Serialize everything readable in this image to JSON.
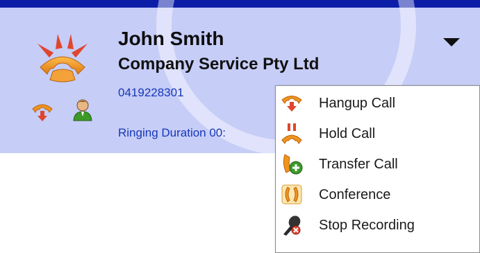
{
  "caller": {
    "name": "John Smith",
    "company": "Company Service Pty Ltd",
    "phone": "0419228301",
    "ringing_duration": "Ringing Duration  00:"
  },
  "icons": {
    "ringing": "ringing-phone-icon",
    "hangup_small": "hangup-phone-icon",
    "contact_small": "contact-person-icon",
    "menu_toggle": "dropdown-arrow-icon"
  },
  "menu": {
    "items": [
      {
        "label": "Hangup Call",
        "icon": "hangup-phone-icon"
      },
      {
        "label": "Hold Call",
        "icon": "hold-phone-icon"
      },
      {
        "label": "Transfer Call",
        "icon": "transfer-call-icon"
      },
      {
        "label": "Conference",
        "icon": "conference-icon"
      },
      {
        "label": "Stop Recording",
        "icon": "microphone-stop-icon"
      }
    ]
  },
  "colors": {
    "panel_background": "#c6cdf7",
    "top_bar": "#0c1ea8",
    "link_text": "#1737b8",
    "phone_orange": "#f0941e",
    "ring_red": "#e0452d",
    "contact_green": "#3d9a2a"
  }
}
